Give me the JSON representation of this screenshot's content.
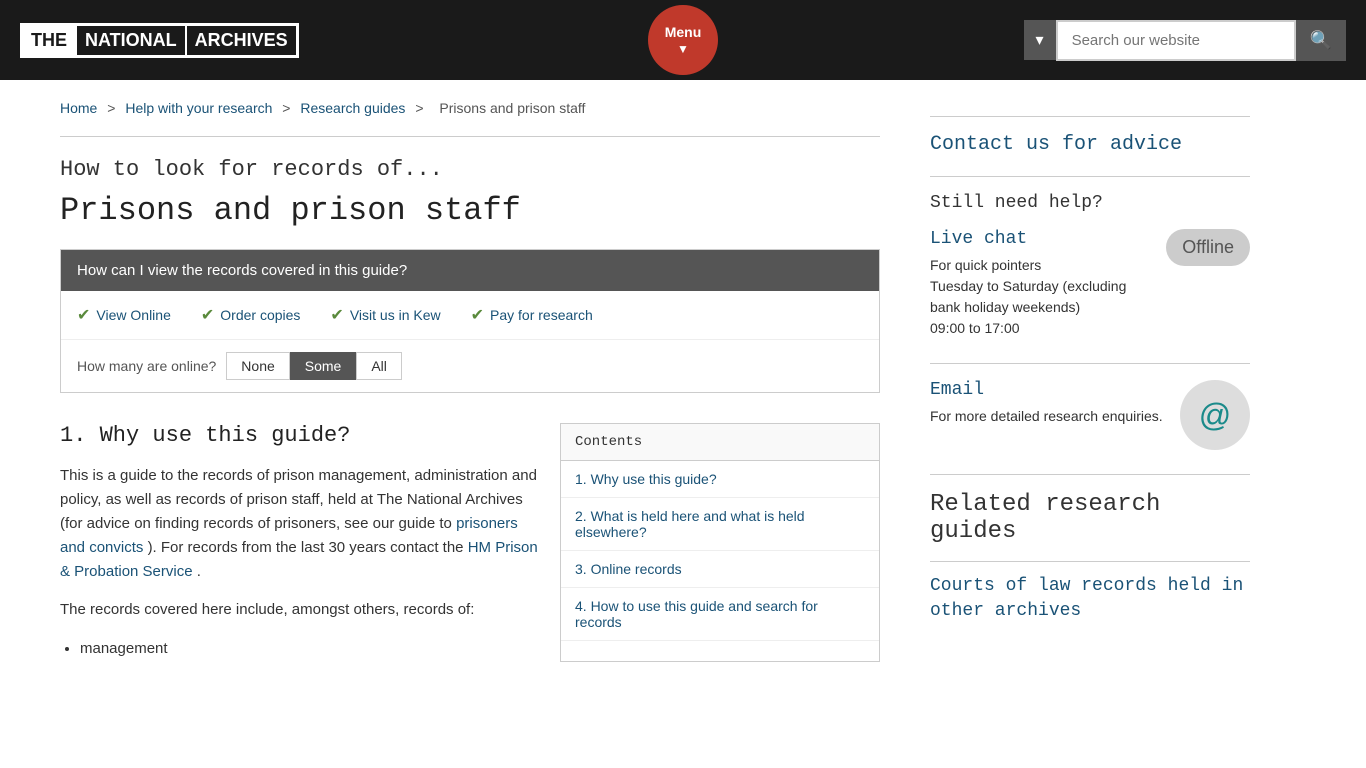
{
  "header": {
    "logo": {
      "the": "THE",
      "national": "NATIONAL",
      "archives": "ARCHIVES"
    },
    "menu_button": "Menu",
    "search_placeholder": "Search our website",
    "search_toggle_label": "▾",
    "search_button_label": "🔍"
  },
  "breadcrumb": {
    "items": [
      {
        "label": "Home",
        "href": "#"
      },
      {
        "label": "Help with your research",
        "href": "#"
      },
      {
        "label": "Research guides",
        "href": "#"
      }
    ],
    "current": "Prisons and prison staff"
  },
  "content": {
    "subtitle": "How to look for records of...",
    "title": "Prisons and prison staff",
    "records_box": {
      "header": "How can I view the records covered in this guide?",
      "options": [
        {
          "label": "View Online",
          "href": "#"
        },
        {
          "label": "Order copies",
          "href": "#"
        },
        {
          "label": "Visit us in Kew",
          "href": "#"
        },
        {
          "label": "Pay for research",
          "href": "#"
        }
      ],
      "filter_label": "How many are online?",
      "filter_options": [
        {
          "label": "None",
          "active": false
        },
        {
          "label": "Some",
          "active": true
        },
        {
          "label": "All",
          "active": false
        }
      ]
    },
    "section1": {
      "heading": "1.  Why use this guide?",
      "body1": "This is a guide to the records of prison management, administration and policy, as well as records of prison staff, held at The National Archives (for advice on finding records of prisoners, see our guide to",
      "link1_text": "prisoners and convicts",
      "link1_href": "#",
      "body2": "). For records from the last 30 years contact the",
      "link2_text": "HM Prison & Probation Service",
      "link2_href": "#",
      "body2_end": ".",
      "body3": "The records covered here include, amongst others, records of:",
      "bullets": [
        "management"
      ]
    },
    "contents": {
      "title": "Contents",
      "items": [
        {
          "label": "1. Why use this guide?",
          "href": "#"
        },
        {
          "label": "2. What is held here and what is held elsewhere?",
          "href": "#"
        },
        {
          "label": "3. Online records",
          "href": "#"
        },
        {
          "label": "4. How to use this guide and search for records",
          "href": "#"
        }
      ]
    }
  },
  "sidebar": {
    "contact_link": "Contact us for advice",
    "still_need_help": "Still need help?",
    "live_chat": {
      "label": "Live chat",
      "href": "#",
      "status": "Offline",
      "desc_line1": "For quick pointers",
      "desc_line2": "Tuesday to Saturday (excluding bank holiday weekends)",
      "desc_line3": "09:00 to 17:00"
    },
    "email": {
      "label": "Email",
      "href": "#",
      "desc": "For more detailed research enquiries."
    },
    "related_title": "Related research guides",
    "related_links": [
      {
        "label": "Courts of law records held in other archives",
        "href": "#"
      }
    ]
  }
}
